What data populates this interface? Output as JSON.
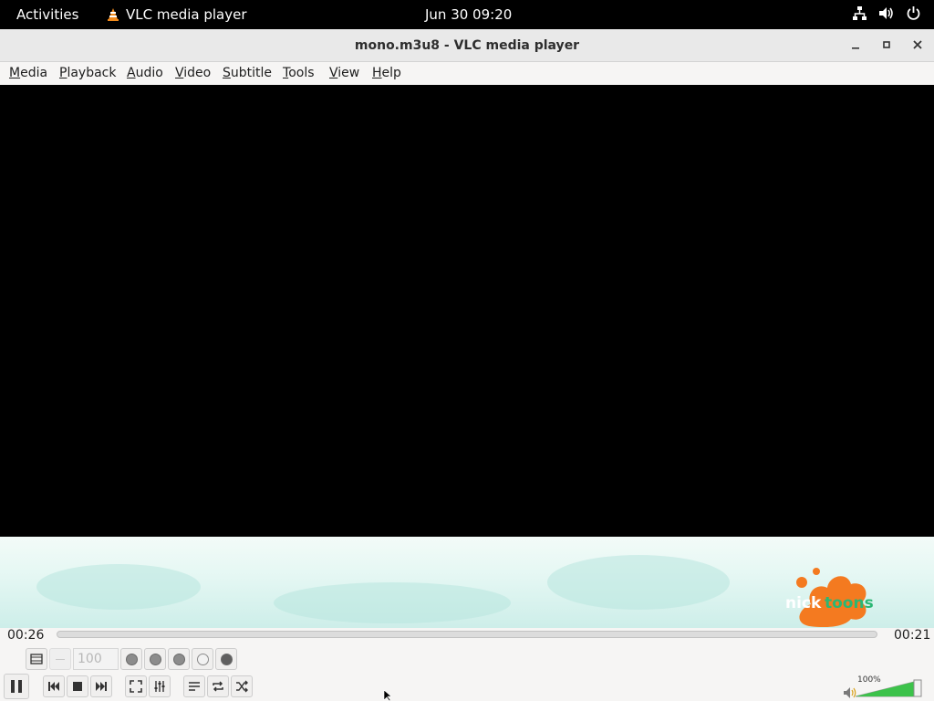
{
  "topbar": {
    "activities": "Activities",
    "app_name": "VLC media player",
    "clock": "Jun 30  09:20",
    "icons": [
      "network-icon",
      "volume-icon",
      "power-icon"
    ]
  },
  "window": {
    "title": "mono.m3u8 - VLC media player",
    "buttons": [
      "minimize",
      "maximize",
      "close"
    ]
  },
  "menu": [
    {
      "label": "Media",
      "mnemonic": "M"
    },
    {
      "label": "Playback",
      "mnemonic": "P"
    },
    {
      "label": "Audio",
      "mnemonic": "A"
    },
    {
      "label": "Video",
      "mnemonic": "V"
    },
    {
      "label": "Subtitle",
      "mnemonic": "S"
    },
    {
      "label": "Tools",
      "mnemonic": "T"
    },
    {
      "label": "View",
      "mnemonic": "V"
    },
    {
      "label": "Help",
      "mnemonic": "H"
    }
  ],
  "video": {
    "logo_text": "nicktoons"
  },
  "playback": {
    "elapsed": "00:26",
    "remaining": "00:21",
    "zoom_value": "100",
    "volume_percent": "100%",
    "volume_level": 1.0
  },
  "colors": {
    "logo_orange": "#f47a20",
    "logo_green": "#2bb673",
    "volume_green": "#3cc24a"
  }
}
